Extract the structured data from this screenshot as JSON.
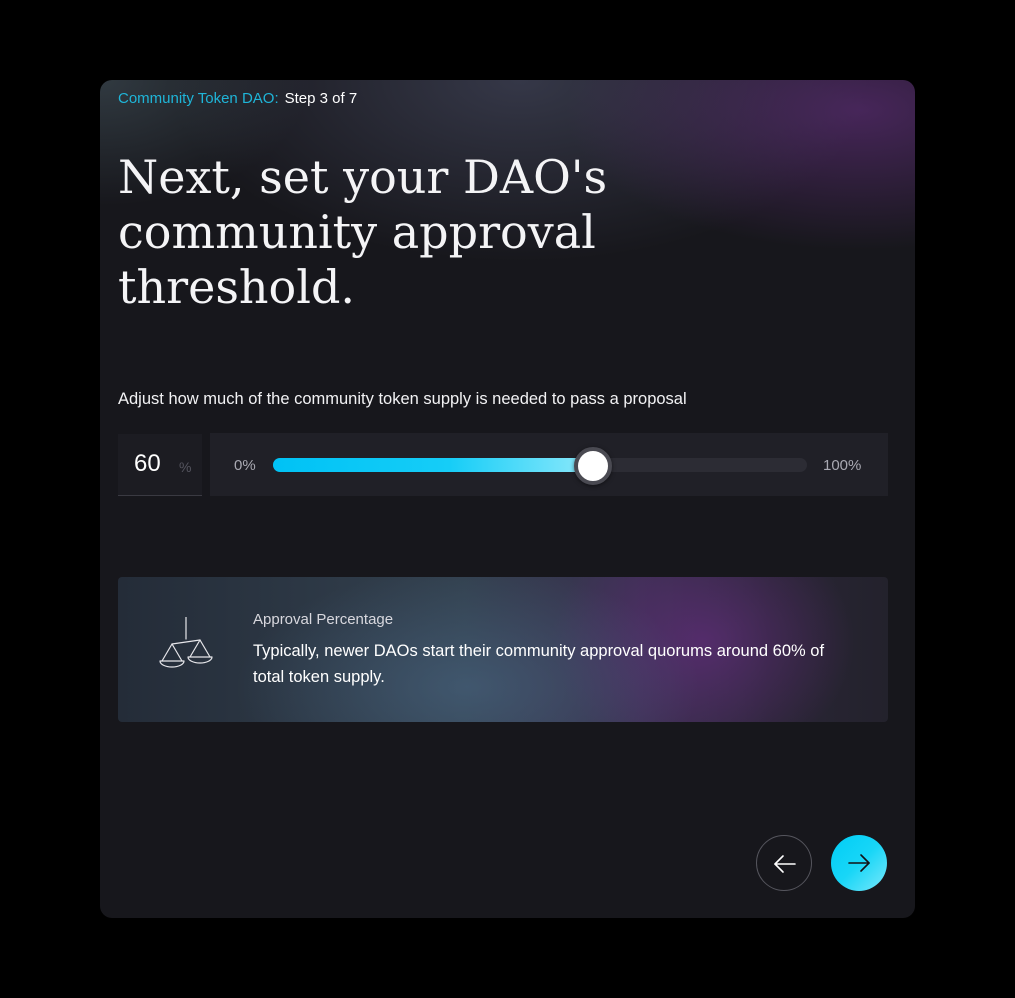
{
  "breadcrumb": {
    "dao_name": "Community Token DAO:",
    "step": "Step 3 of 7"
  },
  "title": "Next, set your DAO's community approval threshold.",
  "instruction": "Adjust how much of the community token supply is needed to pass a proposal",
  "threshold": {
    "value": "60",
    "unit": "%",
    "slider_min_label": "0%",
    "slider_max_label": "100%",
    "slider_level_percent": 60
  },
  "info": {
    "icon": "scale-icon",
    "title": "Approval Percentage",
    "text": "Typically, newer DAOs start their community approval quorums around 60% of total token supply."
  },
  "nav": {
    "back_icon": "arrow-left-icon",
    "next_icon": "arrow-right-icon"
  },
  "colors": {
    "accent": "#00c2f5",
    "dao_name": "#1fb5d8",
    "card_background": "#17171c"
  }
}
